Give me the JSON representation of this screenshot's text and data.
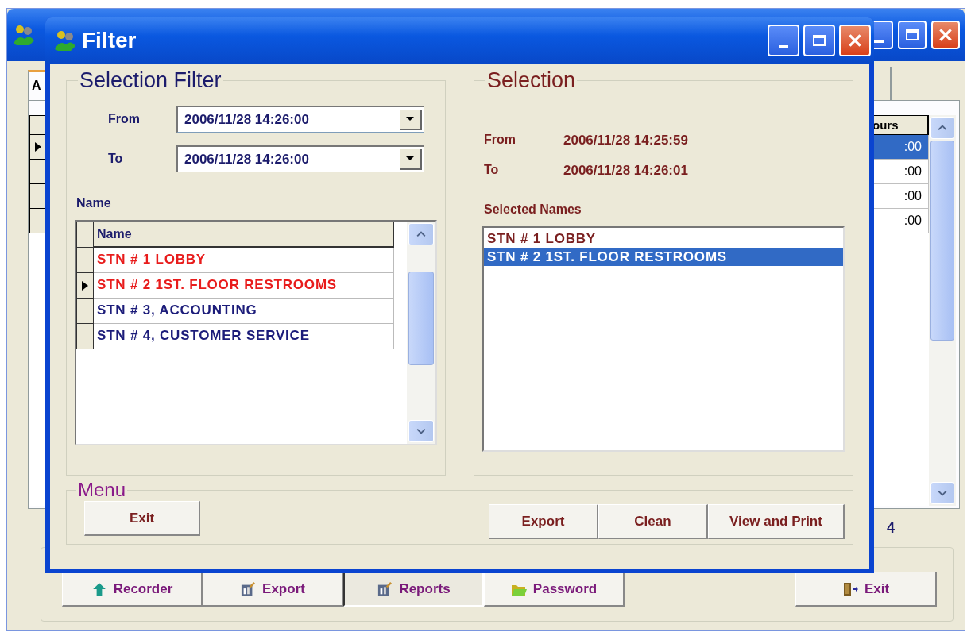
{
  "main_window": {
    "tab": {
      "label": "A",
      "selected": true
    },
    "grid": {
      "column_header": "ours",
      "rows": [
        {
          "current": true,
          "selected": true,
          "cell": ":00"
        },
        {
          "current": false,
          "selected": false,
          "cell": ":00"
        },
        {
          "current": false,
          "selected": false,
          "cell": ":00"
        },
        {
          "current": false,
          "selected": false,
          "cell": ":00"
        }
      ]
    },
    "count": "4",
    "buttons": [
      {
        "label": "Recorder",
        "kind": "arrow",
        "pressed": false
      },
      {
        "label": "Export",
        "kind": "report",
        "pressed": false
      },
      {
        "label": "Reports",
        "kind": "report",
        "pressed": true
      },
      {
        "label": "Password",
        "kind": "folder",
        "pressed": false
      }
    ],
    "exit_button": {
      "label": "Exit",
      "kind": "door",
      "pressed": false
    }
  },
  "dialog": {
    "title": "Filter",
    "selection_filter": {
      "title": "Selection Filter",
      "from_label": "From",
      "from_value": "2006/11/28 14:26:00",
      "to_label": "To",
      "to_value": "2006/11/28 14:26:00",
      "name_label": "Name",
      "grid": {
        "column_header": "Name",
        "rows": [
          {
            "name": "STN # 1 LOBBY",
            "color": "#e81c1c",
            "current": false
          },
          {
            "name": "STN # 2 1ST. FLOOR RESTROOMS",
            "color": "#e81c1c",
            "current": true
          },
          {
            "name": "STN # 3, ACCOUNTING",
            "color": "#1c1c7a",
            "current": false
          },
          {
            "name": "STN # 4, CUSTOMER SERVICE",
            "color": "#1c1c7a",
            "current": false
          }
        ]
      }
    },
    "selection": {
      "title": "Selection",
      "from_label": "From",
      "from_value": "2006/11/28 14:25:59",
      "to_label": "To",
      "to_value": "2006/11/28 14:26:01",
      "names_label": "Selected Names",
      "names": [
        {
          "text": "STN # 1 LOBBY",
          "selected": false
        },
        {
          "text": "STN # 2 1ST. FLOOR RESTROOMS",
          "selected": true
        }
      ]
    },
    "menu": {
      "title": "Menu",
      "exit_button": "Exit",
      "buttons": [
        "Export",
        "Clean",
        "View and Print"
      ]
    }
  }
}
